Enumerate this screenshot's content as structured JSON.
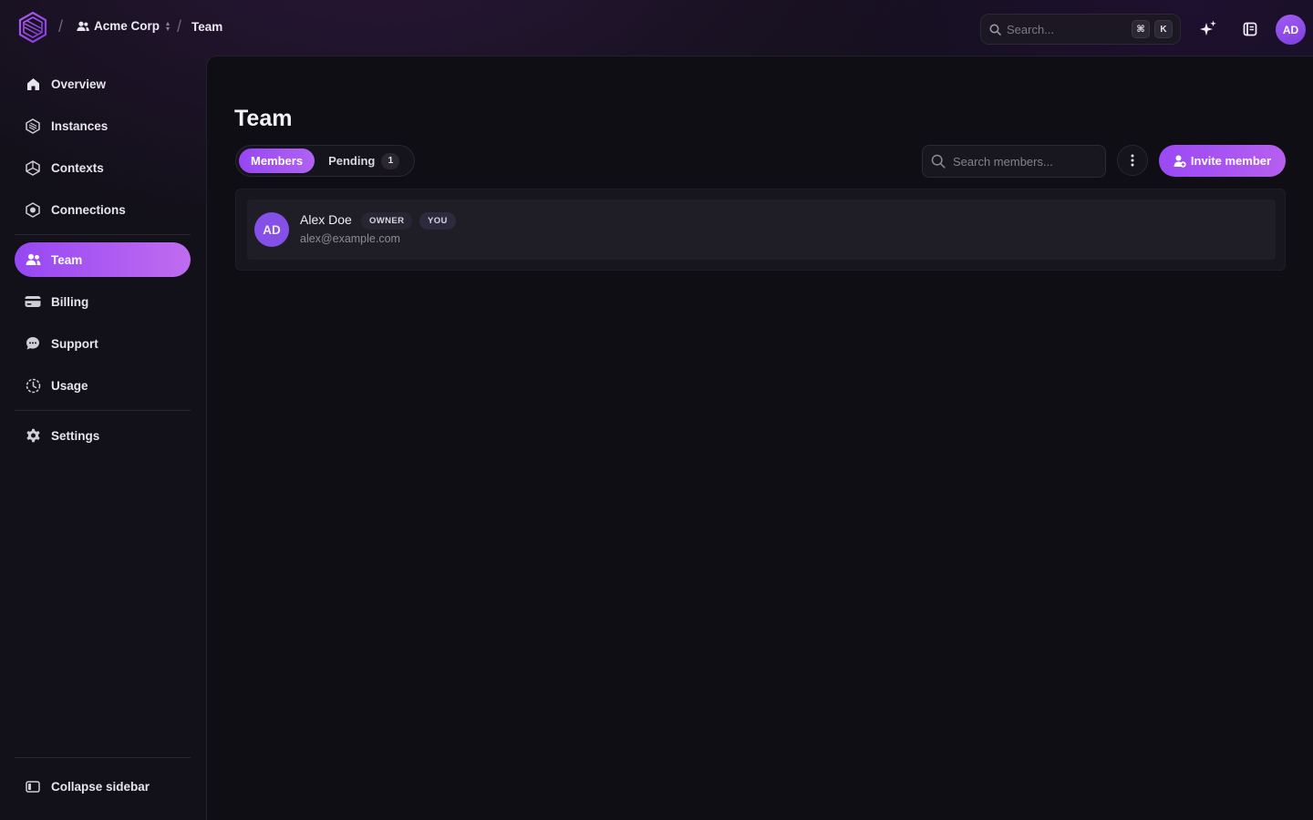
{
  "breadcrumb": {
    "org_name": "Acme Corp",
    "current_page": "Team",
    "separator": "/"
  },
  "topbar": {
    "search_placeholder": "Search...",
    "shortcut_keys": [
      "⌘",
      "K"
    ],
    "user_initials": "AD"
  },
  "sidebar": {
    "items": [
      {
        "label": "Overview",
        "icon": "home-icon"
      },
      {
        "label": "Instances",
        "icon": "instances-icon"
      },
      {
        "label": "Contexts",
        "icon": "contexts-icon"
      },
      {
        "label": "Connections",
        "icon": "connections-icon"
      },
      {
        "label": "Team",
        "icon": "team-icon",
        "active": true
      },
      {
        "label": "Billing",
        "icon": "credit-card-icon"
      },
      {
        "label": "Support",
        "icon": "chat-icon"
      },
      {
        "label": "Usage",
        "icon": "clock-icon"
      },
      {
        "label": "Settings",
        "icon": "gear-icon"
      }
    ],
    "collapse_label": "Collapse sidebar"
  },
  "main": {
    "title": "Team",
    "tabs": [
      {
        "label": "Members",
        "active": true
      },
      {
        "label": "Pending",
        "count": "1"
      }
    ],
    "search_placeholder": "Search members...",
    "invite_label": "Invite member",
    "members": [
      {
        "initials": "AD",
        "name": "Alex Doe",
        "email": "alex@example.com",
        "role_badge": "OWNER",
        "self_badge": "YOU"
      }
    ]
  },
  "colors": {
    "accent": "#9647f3",
    "accent_end": "#c06cf0",
    "background": "#121019",
    "panel": "#0f0e14"
  }
}
